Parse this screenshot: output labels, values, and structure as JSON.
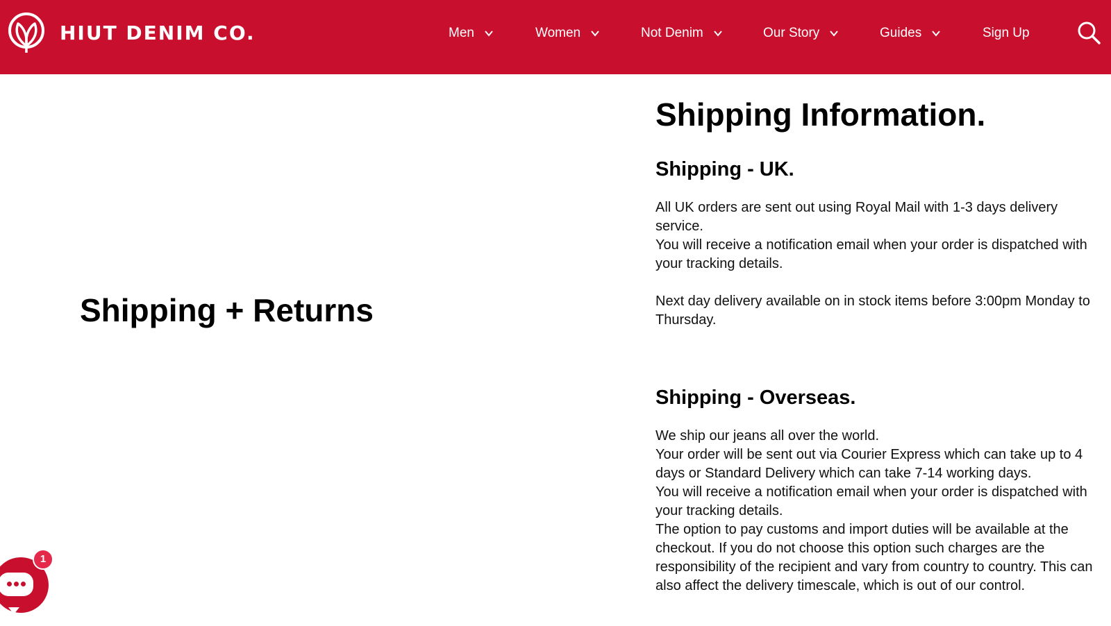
{
  "header": {
    "brand": "HIUT DENIM CO.",
    "logo_icon": "leaf-circle-logo",
    "background_color": "#c8102e",
    "nav": [
      {
        "label": "Men",
        "has_dropdown": true
      },
      {
        "label": "Women",
        "has_dropdown": true
      },
      {
        "label": "Not Denim",
        "has_dropdown": true
      },
      {
        "label": "Our Story",
        "has_dropdown": true
      },
      {
        "label": "Guides",
        "has_dropdown": true
      },
      {
        "label": "Sign Up",
        "has_dropdown": false
      }
    ],
    "search_icon": "search-icon"
  },
  "page": {
    "title": "Shipping + Returns"
  },
  "content": {
    "heading": "Shipping Information.",
    "uk": {
      "title": "Shipping - UK.",
      "lines": [
        "All UK orders are sent out using Royal Mail with 1-3 days delivery service.",
        "You will receive a notification email when your order is dispatched with your tracking details.",
        "",
        "Next day delivery available on in stock items before 3:00pm Monday to Thursday."
      ]
    },
    "overseas": {
      "title": "Shipping - Overseas.",
      "lines": [
        "We ship our jeans all over the world.",
        "Your order will be sent out via Courier Express which can take up to 4 days or Standard Delivery which can take 7-14 working days.",
        "You will receive a notification email when your order is dispatched with your tracking details.",
        "The option to pay customs and import duties will be available at the checkout. If you do not choose this option such charges are the responsibility of the recipient and vary from country to country. This can also affect the delivery timescale, which is out of our control."
      ]
    }
  },
  "chat": {
    "icon": "chat-bubble-icon",
    "badge_count": "1",
    "accent_color": "#c8102e"
  }
}
